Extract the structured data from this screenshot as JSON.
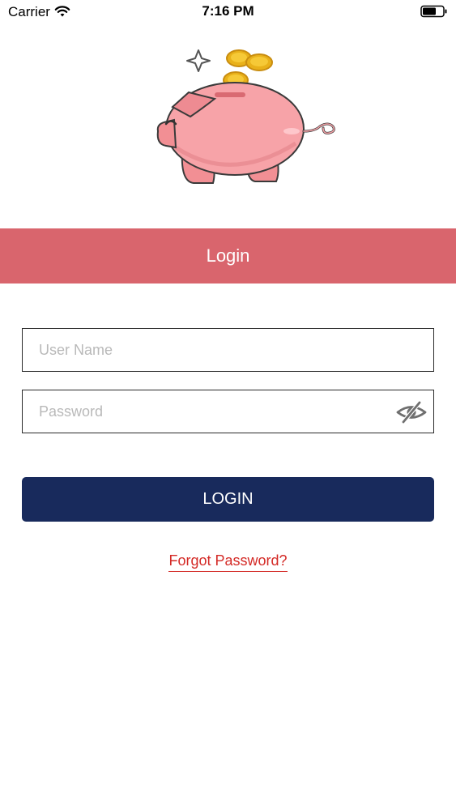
{
  "status_bar": {
    "carrier": "Carrier",
    "time": "7:16 PM",
    "wifi_icon": "wifi-icon",
    "battery_icon": "battery-icon"
  },
  "hero": {
    "illustration": "piggy-bank-icon",
    "coin_icon": "coin-icon",
    "sparkle_icon": "sparkle-icon"
  },
  "header": {
    "title": "Login",
    "color": "#d9656d"
  },
  "form": {
    "username": {
      "placeholder": "User Name",
      "value": ""
    },
    "password": {
      "placeholder": "Password",
      "value": "",
      "toggle_icon": "eye-slash-icon"
    },
    "login_button": {
      "label": "LOGIN",
      "color": "#182a5c"
    },
    "forgot_password": {
      "label": "Forgot Password?",
      "color": "#d42a26"
    }
  }
}
